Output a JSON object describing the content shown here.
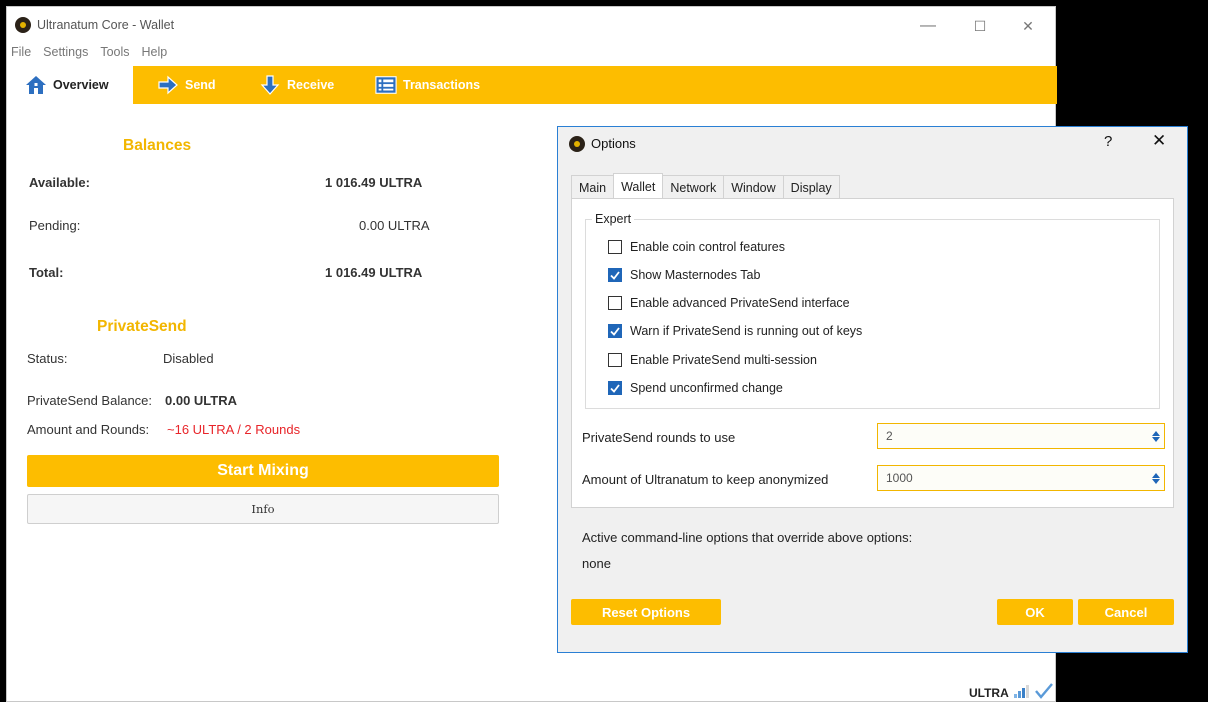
{
  "window": {
    "title": "Ultranatum Core - Wallet",
    "minimize": "—",
    "maximize": "☐",
    "close": "✕"
  },
  "menu": [
    "File",
    "Settings",
    "Tools",
    "Help"
  ],
  "tabs": [
    {
      "label": "Overview",
      "icon": "home-icon",
      "active": true
    },
    {
      "label": "Send",
      "icon": "arrow-right-icon",
      "active": false
    },
    {
      "label": "Receive",
      "icon": "arrow-down-icon",
      "active": false
    },
    {
      "label": "Transactions",
      "icon": "list-icon",
      "active": false
    }
  ],
  "balances": {
    "title": "Balances",
    "available_label": "Available:",
    "available_value": "1 016.49 ULTRA",
    "pending_label": "Pending:",
    "pending_value": "0.00 ULTRA",
    "total_label": "Total:",
    "total_value": "1 016.49 ULTRA"
  },
  "privatesend": {
    "title": "PrivateSend",
    "status_label": "Status:",
    "status_value": "Disabled",
    "balance_label": "PrivateSend Balance:",
    "balance_value": "0.00 ULTRA",
    "rounds_label": "Amount and Rounds:",
    "rounds_value": "~16 ULTRA / 2 Rounds",
    "start_button": "Start Mixing",
    "info_button": "Info"
  },
  "statusbar": {
    "unit": "ULTRA"
  },
  "options": {
    "title": "Options",
    "help": "?",
    "close": "✕",
    "tabs": [
      "Main",
      "Wallet",
      "Network",
      "Window",
      "Display"
    ],
    "active_tab": "Wallet",
    "expert": {
      "legend": "Expert",
      "checkboxes": [
        {
          "label": "Enable coin control features",
          "checked": false
        },
        {
          "label": "Show Masternodes Tab",
          "checked": true
        },
        {
          "label": "Enable advanced PrivateSend interface",
          "checked": false
        },
        {
          "label": "Warn if PrivateSend is running out of keys",
          "checked": true
        },
        {
          "label": "Enable PrivateSend multi-session",
          "checked": false
        },
        {
          "label": "Spend unconfirmed change",
          "checked": true
        }
      ]
    },
    "rounds_label": "PrivateSend rounds to use",
    "rounds_value": "2",
    "anon_label": "Amount of Ultranatum to keep anonymized",
    "anon_value": "1000",
    "cmdline_label": "Active command-line options that override above options:",
    "cmdline_value": "none",
    "reset_button": "Reset Options",
    "ok_button": "OK",
    "cancel_button": "Cancel"
  },
  "colors": {
    "accent": "#fdbd00",
    "title_yellow": "#f2b600",
    "warning_red": "#e8252a",
    "checkbox_blue": "#1f66b8",
    "dialog_border": "#2a7fd4"
  }
}
